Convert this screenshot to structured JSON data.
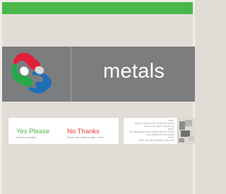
{
  "brand": {
    "name": "metals"
  },
  "choices": {
    "yes": {
      "title": "Yes Please",
      "description": "All types accepted"
    },
    "no": {
      "title": "No Thanks",
      "description": "Waste from metal storage + other"
    }
  },
  "faq": {
    "items": [
      "How?",
      "Make it clear on the metal bin where",
      "and on the right it should go",
      "Why?",
      "So everything that is metal can be reused",
      "and made into new things",
      "How?",
      "Staff can take metals to the yard",
      "and add them to the bin"
    ]
  },
  "colors": {
    "accent_green": "#4bb74a",
    "no_red": "#e23a3a",
    "banner_grey": "#7b7d7e",
    "page_beige": "#e1ddd6"
  }
}
